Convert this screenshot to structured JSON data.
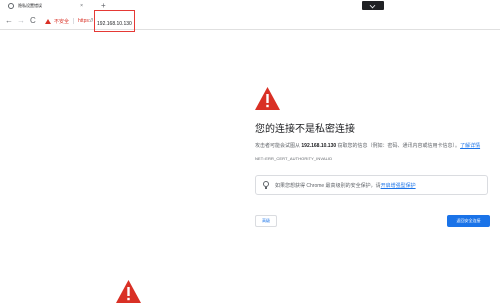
{
  "tab": {
    "title": "隐私设置错误",
    "close": "×",
    "new_tab": "+"
  },
  "toolbar": {
    "back": "←",
    "forward": "→",
    "reload": "C",
    "not_secure": "不安全",
    "url_scheme": "https",
    "url_slashes": "://",
    "url_host": "192.168.10.130"
  },
  "interstitial": {
    "headline": "您的连接不是私密连接",
    "desc_part1": "攻击者可能会试图从 ",
    "desc_host": "192.168.10.130",
    "desc_part2": " 窃取您的信息（例如：密码、通讯内容或信用卡信息）。",
    "desc_link": "了解详情",
    "error_code": "NET::ERR_CERT_AUTHORITY_INVALID",
    "hint_prefix": "如果您想获得 Chrome 最高级别的安全保护，请",
    "hint_link": "开启增强型保护",
    "advanced_label": "高级",
    "back_label": "返回安全连接"
  },
  "colors": {
    "warning_red": "#d93025",
    "link_blue": "#1a73e8",
    "primary_button": "#1a73e8"
  },
  "icons": [
    "chrome-favicon-icon",
    "close-icon",
    "new-tab-icon",
    "back-arrow-icon",
    "forward-arrow-icon",
    "reload-icon",
    "warning-icon",
    "lightbulb-icon"
  ]
}
